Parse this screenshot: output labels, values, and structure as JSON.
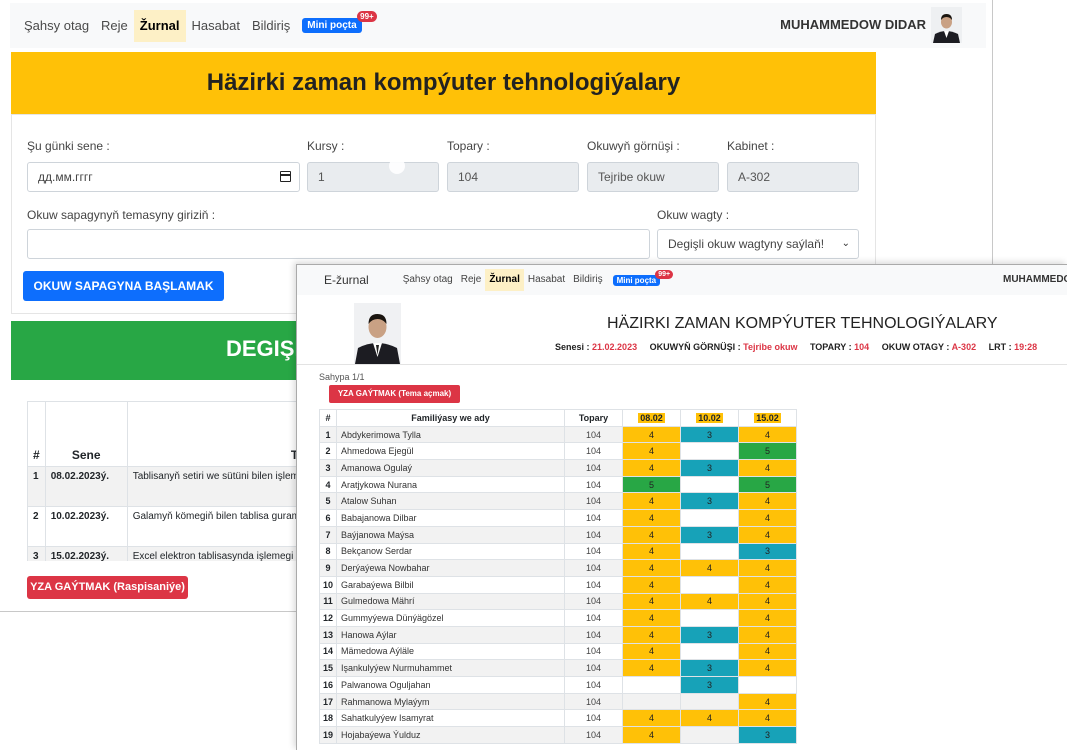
{
  "colors": {
    "warning": "#ffc107",
    "info": "#17a2b8",
    "success": "#28a745",
    "danger": "#dc3545",
    "primary": "#0d6efd"
  },
  "back": {
    "nav": {
      "links": [
        "Şahsy otag",
        "Reje",
        "Žurnal",
        "Hasabat",
        "Bildiriş"
      ],
      "active": "Žurnal",
      "mini_label": "Mini poçta",
      "mini_count": "99+",
      "user_name": "MUHAMMEDOW DIDAR"
    },
    "title": "Häzirki zaman kompýuter tehnologiýalary",
    "form": {
      "date_label": "Şu günki sene :",
      "date_placeholder": "дд.мм.гггг",
      "kurs_label": "Kursy :",
      "kurs_value": "1",
      "topar_label": "Topary :",
      "topar_value": "104",
      "gornus_label": "Okuwyň görnüşi :",
      "gornus_value": "Tejribe okuw",
      "kabinet_label": "Kabinet :",
      "kabinet_value": "A-302",
      "tema_label": "Okuw sapagynyň temasyny giriziň :",
      "wagt_label": "Okuw wagty :",
      "wagt_value": "Degişli okuw wagtyny saýlaň!"
    },
    "start_button": "OKUW SAPAGYNA BAŞLAMAK",
    "green_title": "DEGIŞL",
    "schedule": {
      "headers": [
        "#",
        "Sene",
        "Temar"
      ],
      "rows": [
        {
          "n": "1",
          "date": "08.02.2023ý.",
          "theme": "Tablisanyň setiri we sütüni bilen işleme"
        },
        {
          "n": "2",
          "date": "10.02.2023ý.",
          "theme": "Galamyň kömegiň bilen tablisa guram hasaplamalary geçirmek."
        },
        {
          "n": "3",
          "date": "15.02.2023ý.",
          "theme": "Excel elektron tablisasynda işlemegi ö"
        }
      ]
    },
    "exit_button": "YZA GAÝTMAK (Raspisaniýe)"
  },
  "front": {
    "nav": {
      "brand": "E-žurnal",
      "links": [
        "Şahsy otag",
        "Reje",
        "Žurnal",
        "Hasabat",
        "Bildiriş"
      ],
      "active": "Žurnal",
      "mini_label": "Mini poçta",
      "mini_count": "99+",
      "user_name": "MUHAMMEDOW DIDAR"
    },
    "title": "HÄZIRKI ZAMAN KOMPÝUTER TEHNOLOGIÝALARY",
    "info": {
      "senesi_label": "Senesi :",
      "senesi_value": "21.02.2023",
      "gornus_label": "OKUWYŇ GÖRNÜŞI :",
      "gornus_value": "Tejribe okuw",
      "topary_label": "TOPARY :",
      "topary_value": "104",
      "otag_label": "OKUW OTAGY :",
      "otag_value": "A-302",
      "lrt_label": "LRT :",
      "lrt_value": "19:28"
    },
    "page_info": "Sahypa 1/1",
    "back_button": "YZA GAÝTMAK (Tema açmak)",
    "table": {
      "headers": [
        "#",
        "Familiýasy we ady",
        "Topary",
        "08.02",
        "10.02",
        "15.02"
      ],
      "rows": [
        {
          "n": "1",
          "name": "Abdykerimowa Tylla",
          "group": "104",
          "grades": [
            "4",
            "3",
            "4"
          ]
        },
        {
          "n": "2",
          "name": "Ahmedowa Ejegül",
          "group": "104",
          "grades": [
            "4",
            "",
            "5"
          ]
        },
        {
          "n": "3",
          "name": "Amanowa Ogulaý",
          "group": "104",
          "grades": [
            "4",
            "3",
            "4"
          ]
        },
        {
          "n": "4",
          "name": "Aratjykowa Nurana",
          "group": "104",
          "grades": [
            "5",
            "",
            "5"
          ]
        },
        {
          "n": "5",
          "name": "Atalow Suhan",
          "group": "104",
          "grades": [
            "4",
            "3",
            "4"
          ]
        },
        {
          "n": "6",
          "name": "Babajanowa Dilbar",
          "group": "104",
          "grades": [
            "4",
            "",
            "4"
          ]
        },
        {
          "n": "7",
          "name": "Baýjanowa Maýsa",
          "group": "104",
          "grades": [
            "4",
            "3",
            "4"
          ]
        },
        {
          "n": "8",
          "name": "Bekçanow Serdar",
          "group": "104",
          "grades": [
            "4",
            "",
            "3"
          ]
        },
        {
          "n": "9",
          "name": "Derýaýewa Nowbahar",
          "group": "104",
          "grades": [
            "4",
            "4",
            "4"
          ]
        },
        {
          "n": "10",
          "name": "Garabaýewa Bilbil",
          "group": "104",
          "grades": [
            "4",
            "",
            "4"
          ]
        },
        {
          "n": "11",
          "name": "Gulmedowa Mährí",
          "group": "104",
          "grades": [
            "4",
            "4",
            "4"
          ]
        },
        {
          "n": "12",
          "name": "Gummyýewa Dünýägözel",
          "group": "104",
          "grades": [
            "4",
            "",
            "4"
          ]
        },
        {
          "n": "13",
          "name": "Hanowa Aýlar",
          "group": "104",
          "grades": [
            "4",
            "3",
            "4"
          ]
        },
        {
          "n": "14",
          "name": "Mämedowa Aýläle",
          "group": "104",
          "grades": [
            "4",
            "",
            "4"
          ]
        },
        {
          "n": "15",
          "name": "Işankulyýew Nurmuhammet",
          "group": "104",
          "grades": [
            "4",
            "3",
            "4"
          ]
        },
        {
          "n": "16",
          "name": "Palwanowa Oguljahan",
          "group": "104",
          "grades": [
            "",
            "3",
            ""
          ]
        },
        {
          "n": "17",
          "name": "Rahmanowa Mylaýym",
          "group": "104",
          "grades": [
            "",
            "",
            "4"
          ]
        },
        {
          "n": "18",
          "name": "Sahatkulyýew Isamyrat",
          "group": "104",
          "grades": [
            "4",
            "4",
            "4"
          ]
        },
        {
          "n": "19",
          "name": "Hojabaýewa Ýulduz",
          "group": "104",
          "grades": [
            "4",
            "",
            "3"
          ]
        }
      ]
    }
  }
}
